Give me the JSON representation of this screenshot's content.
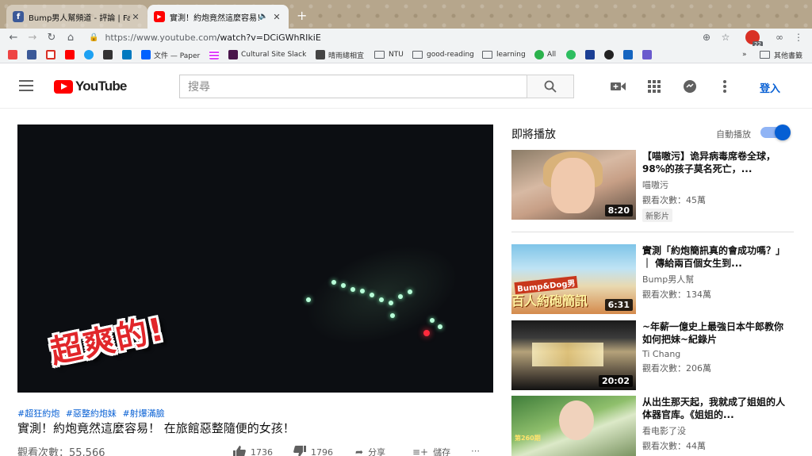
{
  "browser": {
    "tabs": [
      {
        "title": "Bump男人幫頻道 - 評論 | Facebook",
        "active": false,
        "favicon": "facebook-icon"
      },
      {
        "title": "實測！約炮竟然這麼容易！在旅館",
        "active": true,
        "favicon": "youtube-icon"
      }
    ],
    "new_tab": "+",
    "url_host": "https://www.youtube.com",
    "url_path": "/watch?v=DCiGWhRIkiE",
    "extension_badge": "22",
    "bookmarks": [
      {
        "label": "",
        "icon": "bookmark-icon-1"
      },
      {
        "label": "",
        "icon": "facebook-icon"
      },
      {
        "label": "",
        "icon": "gmail-icon"
      },
      {
        "label": "",
        "icon": "youtube-icon"
      },
      {
        "label": "",
        "icon": "twitter-icon"
      },
      {
        "label": "",
        "icon": "hackmd-icon"
      },
      {
        "label": "",
        "icon": "trello-icon"
      },
      {
        "label": "文件 — Paper",
        "icon": "dropbox-icon"
      },
      {
        "label": "",
        "icon": "pattern-icon"
      },
      {
        "label": "Cultural Site Slack",
        "icon": "slack-icon"
      },
      {
        "label": "晴雨總相宜",
        "icon": "page-icon"
      },
      {
        "label": "NTU",
        "icon": "folder-icon"
      },
      {
        "label": "good-reading",
        "icon": "folder-icon"
      },
      {
        "label": "learning",
        "icon": "folder-icon"
      },
      {
        "label": "All",
        "icon": "feedly-icon"
      },
      {
        "label": "其他書籤",
        "icon": "folder-icon"
      }
    ]
  },
  "youtube": {
    "logo_text": "YouTube",
    "search_placeholder": "搜尋",
    "sign_in": "登入"
  },
  "video": {
    "overlay_text": "超爽的!",
    "tags": [
      "#超狂約炮",
      "#惡整約炮妹",
      "#射爆滿臉"
    ],
    "title": "實測！約炮竟然這麼容易！ 在旅館惡整隨便的女孩！",
    "views": "觀看次數：55,566",
    "likes": "1736",
    "dislikes": "1796",
    "share": "分享",
    "save": "儲存"
  },
  "sidebar": {
    "up_next": "即將播放",
    "autoplay": "自動播放",
    "autoplay_on": true,
    "items": [
      {
        "title": "【喵嗷污】诡异病毒席卷全球，98%的孩子莫名死亡，...",
        "channel": "喵嗷污",
        "views": "觀看次數：45萬",
        "badge": "新影片",
        "duration": "8:20"
      },
      {
        "title": "實測「約炮簡訊真的會成功嗎？」｜ 傳給兩百個女生到...",
        "channel": "Bump男人幫",
        "views": "觀看次數：134萬",
        "badge": "",
        "duration": "6:31",
        "thumb_text": "Bump&Dog男",
        "thumb_banner": "百人約砲簡訊"
      },
      {
        "title": "~年薪一億史上最強日本牛郎教你如何把妹~紀錄片",
        "channel": "Ti Chang",
        "views": "觀看次數：206萬",
        "badge": "",
        "duration": "20:02"
      },
      {
        "title": "从出生那天起，我就成了姐姐的人体器官库。《姐姐的...",
        "channel": "看电影了没",
        "views": "觀看次數：44萬",
        "badge": "",
        "duration": "",
        "thumb_text": "第260期"
      }
    ]
  }
}
